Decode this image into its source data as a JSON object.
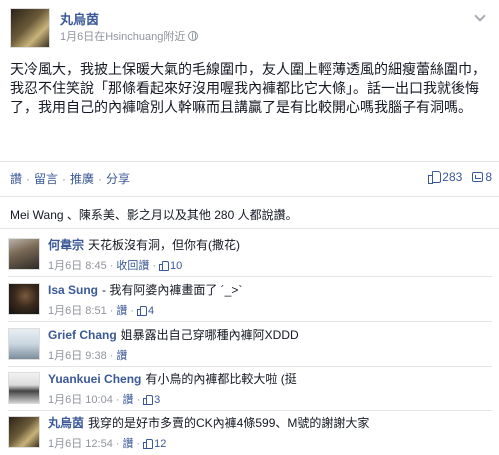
{
  "post": {
    "author": "丸烏茵",
    "meta": "1月6日在Hsinchuang附近",
    "body": "天冷風大，我披上保暖大氣的毛線圍巾，友人圍上輕薄透風的細瘦蕾絲圍巾，我忍不住笑說「那條看起來好沒用喔我內褲都比它大條」。話一出口我就後悔了，我用自己的內褲嗆別人幹嘛而且講贏了是有比較開心嗎我腦子有洞嗎。"
  },
  "actions": {
    "like": "讚",
    "comment": "留言",
    "promote": "推廣",
    "share": "分享",
    "separator": "·"
  },
  "counts": {
    "likes": "283",
    "shares": "8"
  },
  "likers_text": "Mei Wang 、陳系美、影之月以及其他 280 人都說讚。",
  "comments": [
    {
      "name": "何韋宗",
      "text": "天花板沒有洞，但你有(撒花)",
      "date": "1月6日 8:45",
      "action": "收回讚",
      "likes": "10"
    },
    {
      "name": "Isa Sung",
      "text": "- 我有阿婆內褲畫面了 ´_>`",
      "date": "1月6日 8:51",
      "action": "讚",
      "likes": "4"
    },
    {
      "name": "Grief Chang",
      "text": "姐暴露出自己穿哪種內褲阿XDDD",
      "date": "1月6日 9:38",
      "action": "讚",
      "likes": ""
    },
    {
      "name": "Yuankuei Cheng",
      "text": "有小鳥的內褲都比較大啦 (挺",
      "date": "1月6日 10:04",
      "action": "讚",
      "likes": "3"
    },
    {
      "name": "丸烏茵",
      "text": "我穿的是好市多賣的CK內褲4條599、M號的謝謝大家",
      "date": "1月6日 12:54",
      "action": "讚",
      "likes": "12"
    }
  ]
}
